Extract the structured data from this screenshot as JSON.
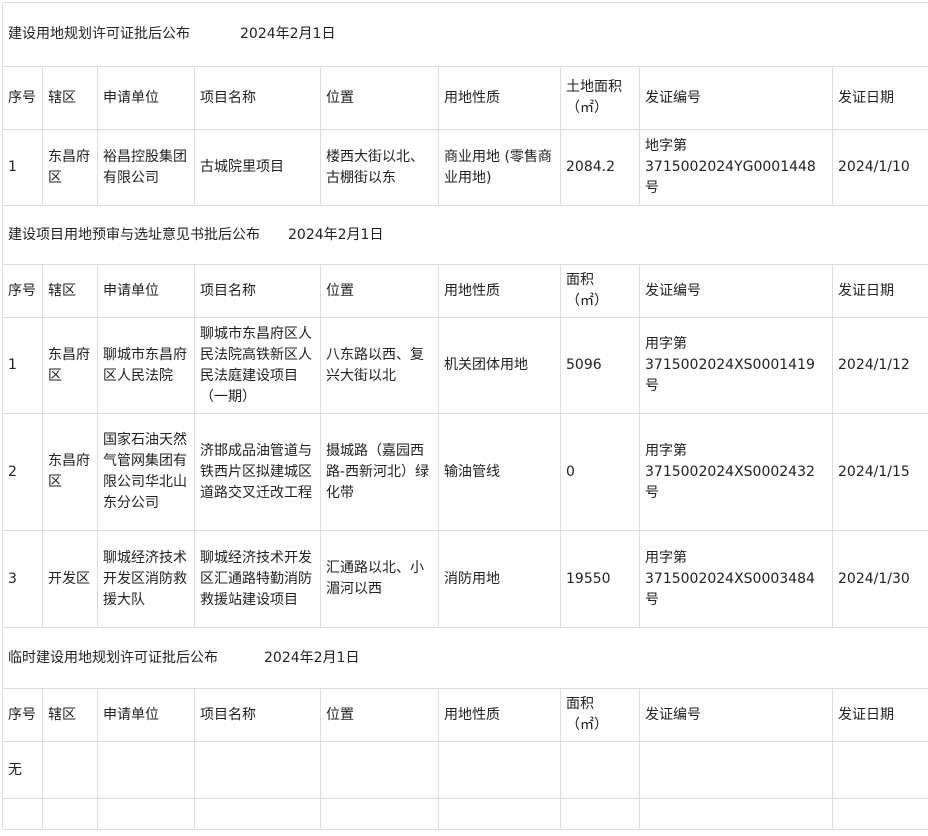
{
  "sections": [
    {
      "title": "建设用地规划许可证批后公布",
      "date": "2024年2月1日",
      "headers": {
        "seq": "序号",
        "district": "辖区",
        "applicant": "申请单位",
        "project": "项目名称",
        "location": "位置",
        "land_use": "用地性质",
        "area_label": "土地面积",
        "area_unit": "（㎡）",
        "cert_no": "发证编号",
        "issue_date": "发证日期"
      },
      "rows": [
        {
          "seq": "1",
          "district": "东昌府区",
          "applicant": "裕昌控股集团有限公司",
          "project": "古城院里项目",
          "location": "楼西大街以北、古棚街以东",
          "land_use": "商业用地 (零售商业用地)",
          "area": "2084.2",
          "cert_no_1": "地字第",
          "cert_no_2": "3715002024YG0001448",
          "cert_no_3": "号",
          "issue_date": "2024/1/10"
        }
      ]
    },
    {
      "title": "建设项目用地预审与选址意见书批后公布",
      "date": "2024年2月1日",
      "headers": {
        "seq": "序号",
        "district": "辖区",
        "applicant": "申请单位",
        "project": "项目名称",
        "location": "位置",
        "land_use": "用地性质",
        "area_label": "面积",
        "area_unit": "（㎡）",
        "cert_no": "发证编号",
        "issue_date": "发证日期"
      },
      "rows": [
        {
          "seq": "1",
          "district": "东昌府区",
          "applicant": "聊城市东昌府区人民法院",
          "project": "聊城市东昌府区人民法院高铁新区人民法庭建设项目（一期）",
          "location": "八东路以西、复兴大街以北",
          "land_use": "机关团体用地",
          "area": "5096",
          "cert_no_1": "用字第",
          "cert_no_2": "3715002024XS0001419",
          "cert_no_3": "号",
          "issue_date": "2024/1/12"
        },
        {
          "seq": "2",
          "district": "东昌府区",
          "applicant": "国家石油天然气管网集团有限公司华北山东分公司",
          "project": "济邯成品油管道与铁西片区拟建城区道路交叉迁改工程",
          "location": "摄城路（嘉园西路-西新河北）绿化带",
          "land_use": "输油管线",
          "area": "0",
          "cert_no_1": "用字第",
          "cert_no_2": "3715002024XS0002432",
          "cert_no_3": "号",
          "issue_date": "2024/1/15"
        },
        {
          "seq": "3",
          "district": "开发区",
          "applicant": "聊城经济技术开发区消防救援大队",
          "project": "聊城经济技术开发区汇通路特勤消防救援站建设项目",
          "location": "汇通路以北、小湄河以西",
          "land_use": "消防用地",
          "area": "19550",
          "cert_no_1": "用字第",
          "cert_no_2": "3715002024XS0003484",
          "cert_no_3": "号",
          "issue_date": "2024/1/30"
        }
      ]
    },
    {
      "title": "临时建设用地规划许可证批后公布",
      "date": "2024年2月1日",
      "headers": {
        "seq": "序号",
        "district": "辖区",
        "applicant": "申请单位",
        "project": "项目名称",
        "location": "位置",
        "land_use": "用地性质",
        "area_label": "面积",
        "area_unit": "（㎡）",
        "cert_no": "发证编号",
        "issue_date": "发证日期"
      },
      "rows": [
        {
          "seq": "无"
        }
      ]
    }
  ]
}
